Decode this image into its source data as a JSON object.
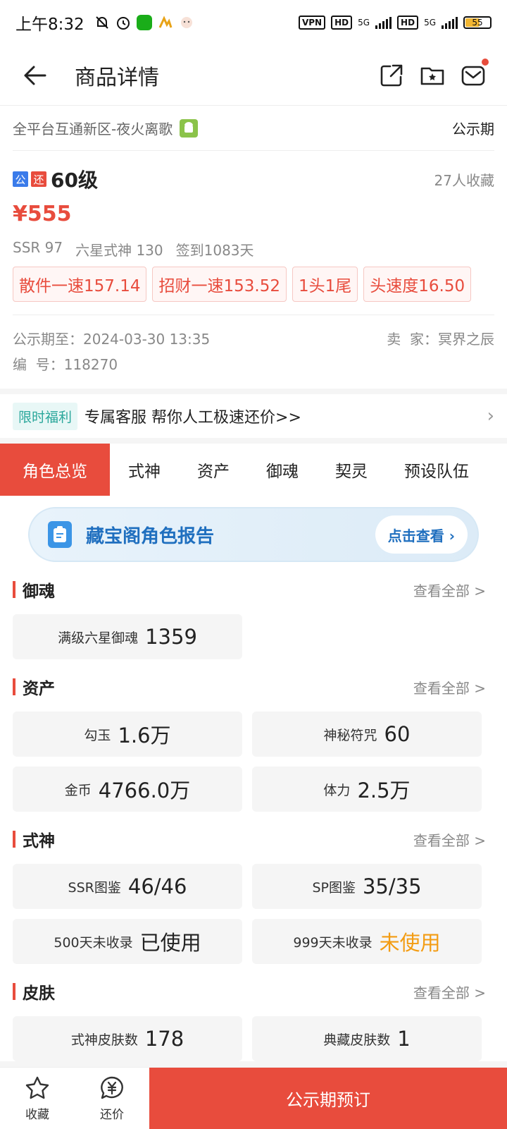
{
  "status_bar": {
    "time": "上午8:32",
    "vpn": "VPN",
    "hd1": "HD",
    "net1": "5G",
    "hd2": "HD",
    "net2": "5G",
    "battery": "55"
  },
  "header": {
    "title": "商品详情",
    "icons": [
      "back-arrow-icon",
      "share-icon",
      "folder-star-icon",
      "mail-icon"
    ]
  },
  "product": {
    "server": "全平台互通新区-夜火离歌",
    "period_label": "公示期",
    "tag_public": "公",
    "tag_bargain": "还",
    "level": "60级",
    "fav_count": "27人收藏",
    "price": "¥555",
    "specs": [
      "SSR 97",
      "六星式神 130",
      "签到1083天"
    ],
    "feature_tags": [
      "散件一速157.14",
      "招财一速153.52",
      "1头1尾",
      "头速度16.50"
    ],
    "period_end": "公示期至：2024-03-30 13:35",
    "seller": "卖  家：冥界之辰",
    "serial": "编  号：118270"
  },
  "promo": {
    "tag": "限时福利",
    "text": "专属客服 帮你人工极速还价>>"
  },
  "tabs": [
    "角色总览",
    "式神",
    "资产",
    "御魂",
    "契灵",
    "预设队伍"
  ],
  "report": {
    "title": "藏宝阁角色报告",
    "button": "点击查看 ›"
  },
  "sections": {
    "view_all": "查看全部 >",
    "yuhun": {
      "title": "御魂",
      "items": [
        {
          "label": "满级六星御魂",
          "value": "1359"
        }
      ]
    },
    "assets": {
      "title": "资产",
      "items": [
        {
          "label": "勾玉",
          "value": "1.6万"
        },
        {
          "label": "神秘符咒",
          "value": "60"
        },
        {
          "label": "金币",
          "value": "4766.0万"
        },
        {
          "label": "体力",
          "value": "2.5万"
        }
      ]
    },
    "shishen": {
      "title": "式神",
      "items": [
        {
          "label": "SSR图鉴",
          "value": "46/46"
        },
        {
          "label": "SP图鉴",
          "value": "35/35"
        },
        {
          "label": "500天未收录",
          "value": "已使用"
        },
        {
          "label": "999天未收录",
          "value": "未使用"
        }
      ]
    },
    "skins": {
      "title": "皮肤",
      "items": [
        {
          "label": "式神皮肤数",
          "value": "178"
        },
        {
          "label": "典藏皮肤数",
          "value": "1"
        }
      ]
    }
  },
  "bottom_bar": {
    "favorite": "收藏",
    "bargain": "还价",
    "reserve": "公示期预订"
  },
  "colors": {
    "accent_red": "#e84c3d",
    "promo_teal": "#2aa79b",
    "report_blue": "#1f6fbf",
    "unused_orange": "#f39c12"
  }
}
